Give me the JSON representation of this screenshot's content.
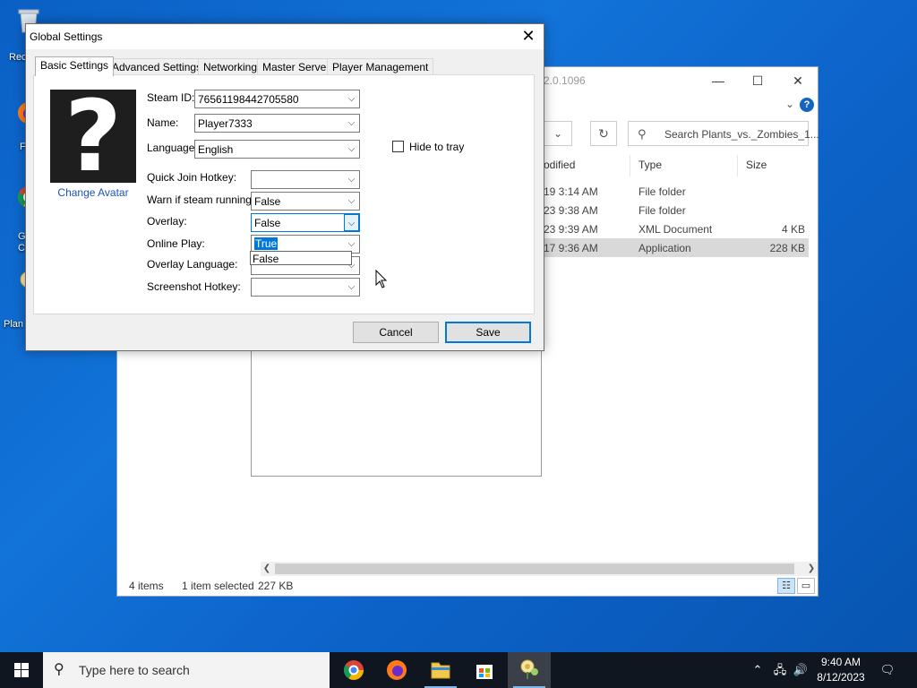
{
  "desktop": {
    "icons": [
      {
        "label": "Rec",
        "icon": "recycle-bin-icon"
      },
      {
        "label": "F",
        "icon": "firefox-shortcut-icon"
      },
      {
        "label": "G\nCh",
        "icon": "chrome-shortcut-icon"
      },
      {
        "label": "Plan",
        "icon": "plants-vs-zombies-shortcut-icon"
      }
    ]
  },
  "explorer": {
    "title_fragment": "2.0.1096",
    "minimize": "—",
    "maximize": "☐",
    "close": "✕",
    "search_placeholder": "Search Plants_vs._Zombies_1...",
    "columns": [
      "odified",
      "Type",
      "Size"
    ],
    "files": [
      {
        "modified": "19 3:14 AM",
        "type": "File folder",
        "size": ""
      },
      {
        "modified": "23 9:38 AM",
        "type": "File folder",
        "size": ""
      },
      {
        "modified": "23 9:39 AM",
        "type": "XML Document",
        "size": "4 KB"
      },
      {
        "modified": "17 9:36 AM",
        "type": "Application",
        "size": "228 KB",
        "selected": true
      }
    ],
    "status": {
      "items": "4 items",
      "selected": "1 item selected",
      "size": "227 KB"
    }
  },
  "dialog": {
    "title": "Global Settings",
    "close": "✕",
    "tabs": [
      "Basic Settings",
      "Advanced Settings",
      "Networking",
      "Master Server",
      "Player Management"
    ],
    "active_tab": 0,
    "avatar_glyph": "?",
    "change_avatar": "Change Avatar",
    "fields": {
      "steam_id": {
        "label": "Steam ID:",
        "value": "76561198442705580"
      },
      "name": {
        "label": "Name:",
        "value": "Player7333"
      },
      "language": {
        "label": "Language:",
        "value": "English"
      },
      "quick_join": {
        "label": "Quick Join Hotkey:",
        "value": ""
      },
      "warn_running": {
        "label": "Warn if steam running:",
        "value": "False"
      },
      "overlay": {
        "label": "Overlay:",
        "value": "False"
      },
      "online_play": {
        "label": "Online Play:",
        "value": "True",
        "options": [
          "False"
        ]
      },
      "overlay_language": {
        "label": "Overlay Language:",
        "value": ""
      },
      "screenshot_hotkey": {
        "label": "Screenshot Hotkey:",
        "value": ""
      }
    },
    "hide_to_tray": {
      "label": "Hide to tray",
      "checked": false
    },
    "buttons": {
      "cancel": "Cancel",
      "save": "Save"
    }
  },
  "taskbar": {
    "search_placeholder": "Type here to search",
    "apps": [
      "chrome-icon",
      "firefox-icon",
      "file-explorer-icon",
      "store-icon",
      "plants-vs-zombies-icon"
    ],
    "time": "9:40 AM",
    "date": "8/12/2023"
  },
  "colors": {
    "accent": "#0078d7",
    "desktop": "#0a5fc4",
    "taskbar": "#101620"
  }
}
